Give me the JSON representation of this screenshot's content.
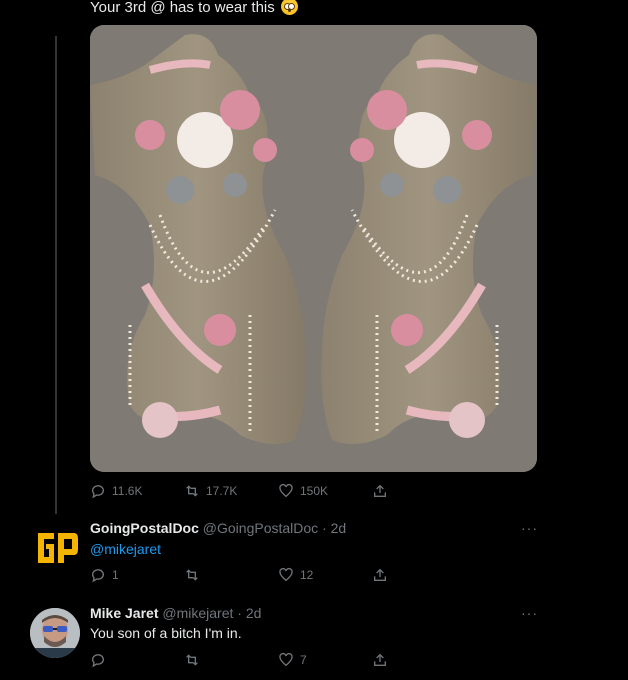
{
  "tweet": {
    "text": "Your 3rd @ has to wear this",
    "emoji": "flushed-face-emoji",
    "stats": {
      "replies": "11.6K",
      "retweets": "17.7K",
      "likes": "150K"
    }
  },
  "replies": [
    {
      "name": "GoingPostalDoc",
      "handle": "@GoingPostalDoc",
      "time": "· 2d",
      "text": "@mikejaret",
      "avatar_text": "GP",
      "stats": {
        "replies": "1",
        "retweets": "",
        "likes": "12"
      }
    },
    {
      "name": "Mike Jaret",
      "handle": "@mikejaret",
      "time": "· 2d",
      "text": "You son of a bitch I'm in.",
      "stats": {
        "replies": "",
        "retweets": "",
        "likes": "7"
      }
    }
  ],
  "more_label": "···",
  "colors": {
    "background": "#000000",
    "text": "#e7e9ea",
    "muted": "#71767b",
    "link": "#1d9bf0",
    "gp_yellow": "#f5b400"
  }
}
